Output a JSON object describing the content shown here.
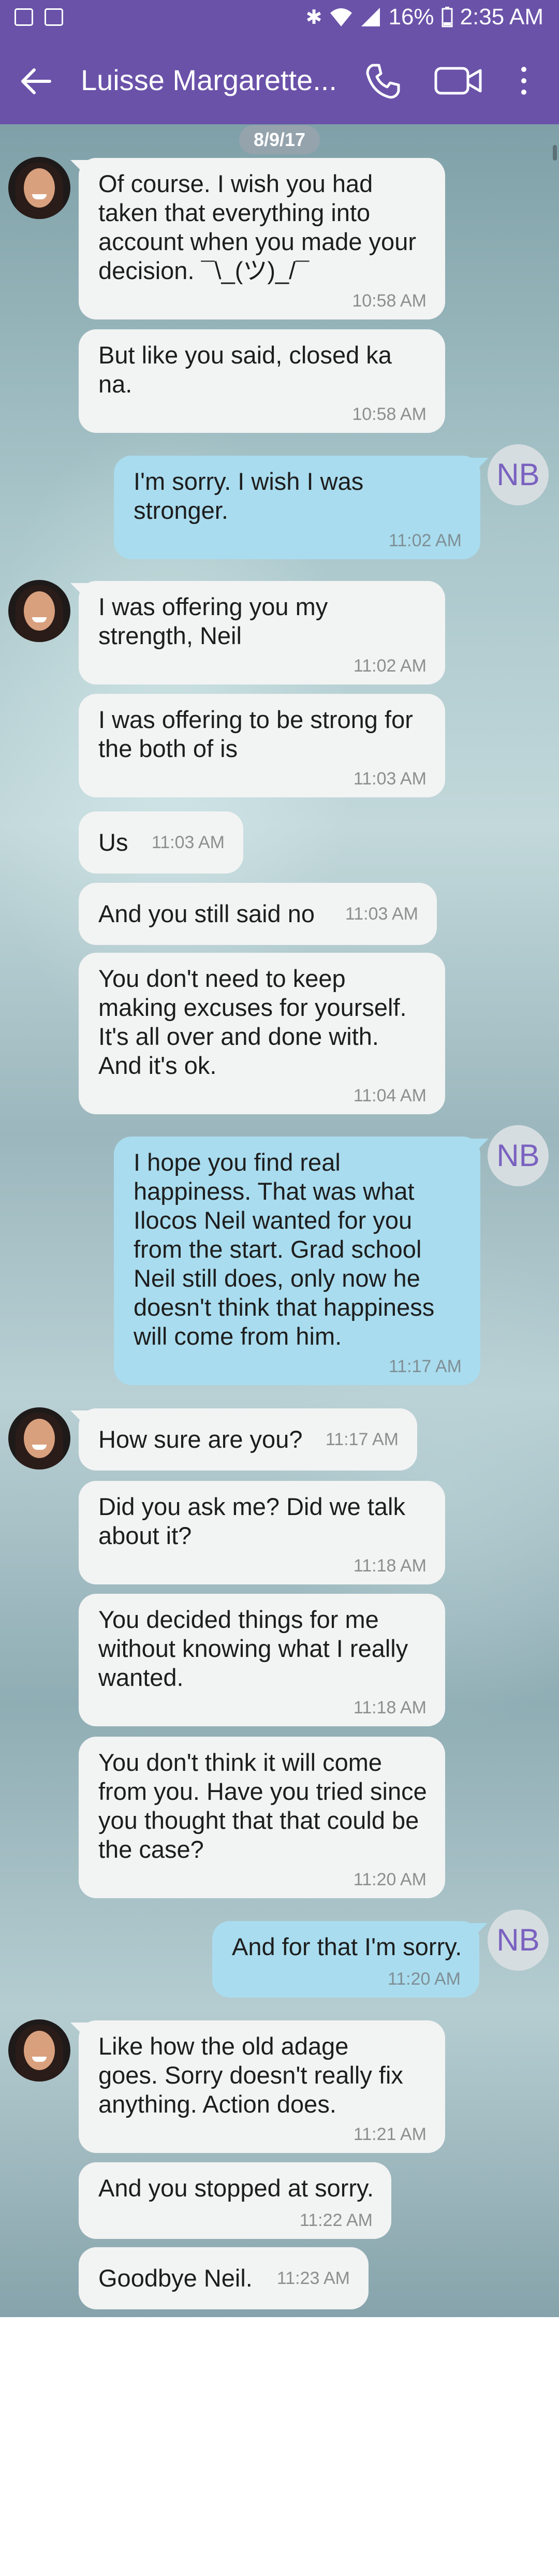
{
  "status_bar": {
    "battery": "16%",
    "time": "2:35 AM"
  },
  "header": {
    "title": "Luisse Margarette..."
  },
  "conversation": {
    "date": "8/9/17",
    "contact_initials": "NB",
    "messages": [
      {
        "dir": "in",
        "text": "Of course. I wish you had\ntaken that everything into\naccount when you made your\ndecision. ¯\\_(ツ)_/¯",
        "time": "10:58 AM"
      },
      {
        "dir": "in",
        "text": "But like you said, closed ka\nna.",
        "time": "10:58 AM"
      },
      {
        "dir": "out",
        "text": "I'm sorry. I wish I was\nstronger.",
        "time": "11:02 AM"
      },
      {
        "dir": "in",
        "text": "I was offering you my\nstrength, Neil",
        "time": "11:02 AM"
      },
      {
        "dir": "in",
        "text": "I was offering to be strong for\nthe both of is",
        "time": "11:03 AM"
      },
      {
        "dir": "in",
        "text": "Us",
        "time": "11:03 AM"
      },
      {
        "dir": "in",
        "text": "And you still said no",
        "time": "11:03 AM"
      },
      {
        "dir": "in",
        "text": "You don't need to keep\nmaking excuses for yourself.\nIt's all over and done with.\nAnd it's ok.",
        "time": "11:04 AM"
      },
      {
        "dir": "out",
        "text": "I hope you find real\nhappiness. That was what\nIlocos Neil wanted for you\nfrom the start. Grad school\nNeil still does, only now he\ndoesn't think that happiness\nwill come from him.",
        "time": "11:17 AM"
      },
      {
        "dir": "in",
        "text": "How sure are you?",
        "time": "11:17 AM"
      },
      {
        "dir": "in",
        "text": "Did you ask me? Did we talk\nabout it?",
        "time": "11:18 AM"
      },
      {
        "dir": "in",
        "text": "You decided things for me\nwithout knowing what I really\nwanted.",
        "time": "11:18 AM"
      },
      {
        "dir": "in",
        "text": "You don't think it will come\nfrom you. Have you tried since\nyou thought that that could be\nthe case?",
        "time": "11:20 AM"
      },
      {
        "dir": "out",
        "text": "And for that I'm sorry.",
        "time": "11:20 AM"
      },
      {
        "dir": "in",
        "text": "Like how the old adage\ngoes. Sorry doesn't really fix\nanything. Action does.",
        "time": "11:21 AM"
      },
      {
        "dir": "in",
        "text": "And you stopped at sorry.",
        "time": "11:22 AM"
      },
      {
        "dir": "in",
        "text": "Goodbye Neil.",
        "time": "11:23 AM"
      }
    ]
  }
}
